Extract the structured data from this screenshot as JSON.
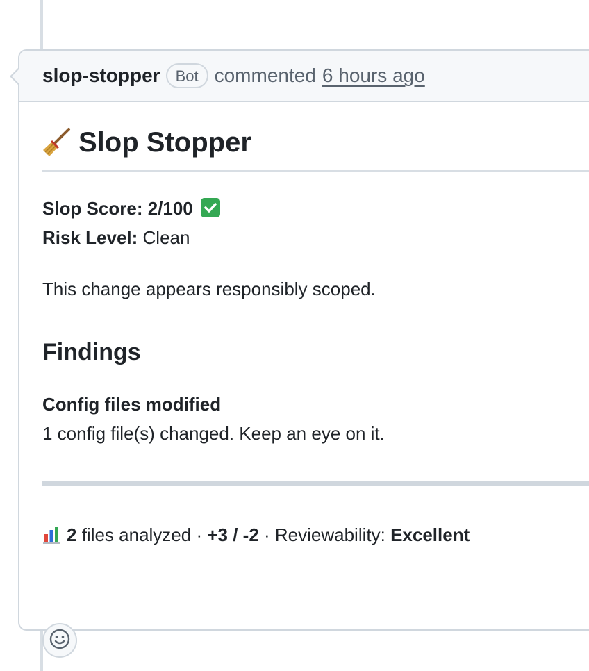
{
  "header": {
    "author": "slop-stopper",
    "badge": "Bot",
    "action": "commented",
    "timestamp": "6 hours ago"
  },
  "body": {
    "title": "Slop Stopper",
    "title_icon": "broom-icon",
    "score_label": "Slop Score: 2/100",
    "score_icon": "check-mark-icon",
    "risk_label": "Risk Level:",
    "risk_value": "Clean",
    "summary": "This change appears responsibly scoped.",
    "findings_heading": "Findings",
    "finding_title": "Config files modified",
    "finding_text": "1 config file(s) changed. Keep an eye on it.",
    "stats": {
      "icon": "bar-chart-icon",
      "files_count": "2",
      "files_text": " files analyzed · ",
      "diff": "+3 / -2",
      "review_text": " · Reviewability: ",
      "review_value": "Excellent"
    }
  },
  "reaction": {
    "icon": "smiley-icon"
  },
  "colors": {
    "border": "#d0d7de",
    "header_bg": "#f6f8fa",
    "muted_text": "#59636e",
    "text": "#1f2328",
    "check_green": "#34a853"
  }
}
